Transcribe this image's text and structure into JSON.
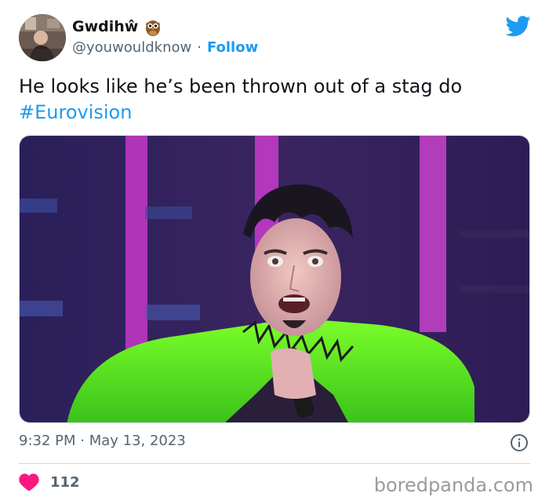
{
  "tweet": {
    "display_name": "Gwdihŵ",
    "handle": "@youwouldknow",
    "separator": "·",
    "follow_label": "Follow",
    "text": "He looks like he’s been thrown out of a stag do",
    "hashtag": "#Eurovision",
    "timestamp": "9:32 PM · May 13, 2023",
    "like_count": "112"
  },
  "icons": {
    "avatar": "avatar-photo",
    "badge": "owl-icon",
    "brand": "twitter-bird-icon",
    "info": "info-icon",
    "like": "heart-icon"
  },
  "colors": {
    "accent": "#1d9bf0",
    "like": "#f91880",
    "muted": "#536471"
  },
  "watermark": "boredpanda.com"
}
